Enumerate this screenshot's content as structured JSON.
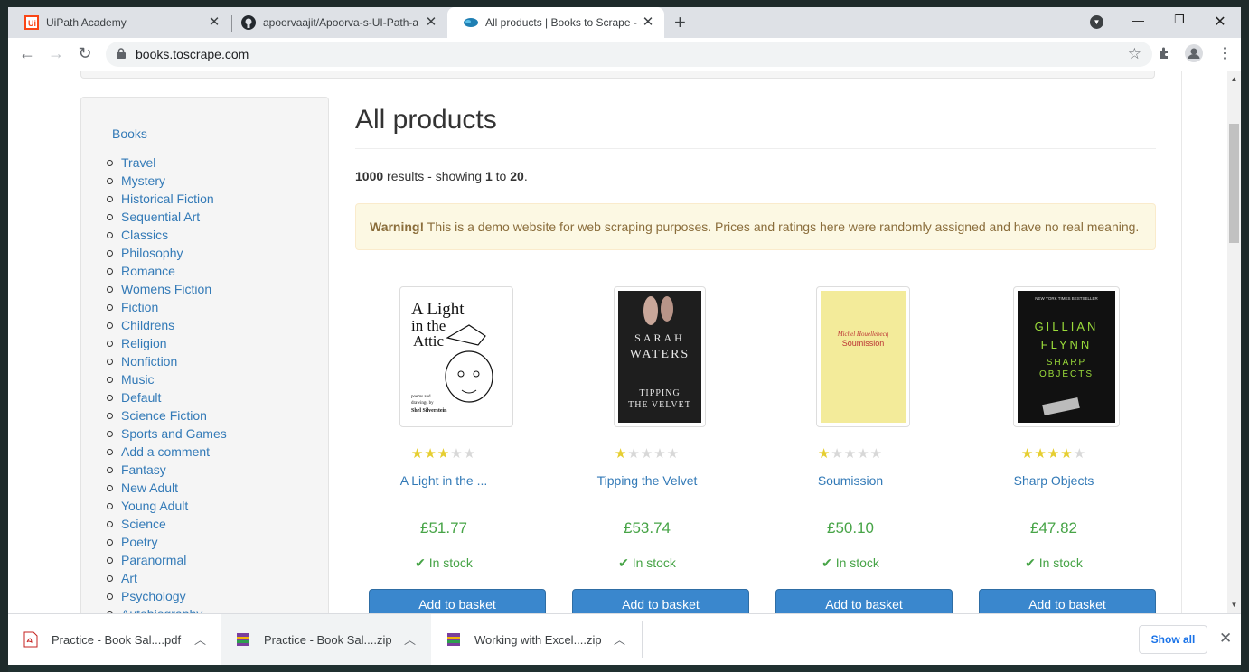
{
  "browser": {
    "tabs": [
      {
        "label": "UiPath Academy",
        "icon": "uipath-icon"
      },
      {
        "label": "apoorvaajit/Apoorva-s-UI-Path-a",
        "icon": "github-icon"
      },
      {
        "label": "All products | Books to Scrape - S",
        "icon": "scrape-icon"
      }
    ],
    "close_glyph": "✕",
    "new_tab_glyph": "+",
    "url": "books.toscrape.com"
  },
  "sidebar": {
    "books_label": "Books",
    "categories": [
      "Travel",
      "Mystery",
      "Historical Fiction",
      "Sequential Art",
      "Classics",
      "Philosophy",
      "Romance",
      "Womens Fiction",
      "Fiction",
      "Childrens",
      "Religion",
      "Nonfiction",
      "Music",
      "Default",
      "Science Fiction",
      "Sports and Games",
      "Add a comment",
      "Fantasy",
      "New Adult",
      "Young Adult",
      "Science",
      "Poetry",
      "Paranormal",
      "Art",
      "Psychology",
      "Autobiography"
    ]
  },
  "main": {
    "title": "All products",
    "results": {
      "count": "1000",
      "text1": " results - showing ",
      "from": "1",
      "text2": " to ",
      "to": "20",
      "end": "."
    },
    "warning": {
      "strong": "Warning!",
      "text": " This is a demo website for web scraping purposes. Prices and ratings here were randomly assigned and have no real meaning."
    },
    "products": [
      {
        "title": "A Light in the ...",
        "price": "£51.77",
        "rating": 3,
        "stock": "In stock",
        "button": "Add to basket",
        "cover_text": {
          "t1": "A Light",
          "t2": "in the",
          "t3": "Attic",
          "sub1": "poems and",
          "sub2": "drawings by",
          "author": "Shel Silverstein"
        }
      },
      {
        "title": "Tipping the Velvet",
        "price": "£53.74",
        "rating": 1,
        "stock": "In stock",
        "button": "Add to basket",
        "cover_text": {
          "t1": "SARAH",
          "t2": "WATERS",
          "t3": "TIPPING",
          "t4": "THE VELVET"
        }
      },
      {
        "title": "Soumission",
        "price": "£50.10",
        "rating": 1,
        "stock": "In stock",
        "button": "Add to basket",
        "cover_text": {
          "t1": "Michel Houellebecq",
          "t2": "Soumission"
        }
      },
      {
        "title": "Sharp Objects",
        "price": "£47.82",
        "rating": 4,
        "stock": "In stock",
        "button": "Add to basket",
        "cover_text": {
          "t1": "GILLIAN",
          "t2": "FLYNN",
          "t3": "SHARP",
          "t4": "OBJECTS",
          "top": "NEW YORK TIMES BESTSELLER"
        }
      }
    ]
  },
  "downloads": {
    "items": [
      {
        "name": "Practice - Book Sal....pdf",
        "icon": "pdf-file-icon"
      },
      {
        "name": "Practice - Book Sal....zip",
        "icon": "zip-archive-icon"
      },
      {
        "name": "Working with Excel....zip",
        "icon": "zip-archive-icon"
      }
    ],
    "show_all": "Show all"
  },
  "colors": {
    "link": "#337ab7",
    "price": "#47a447",
    "button": "#3a87cd",
    "star_on": "#e6ce31",
    "star_off": "#d8d8d8"
  }
}
